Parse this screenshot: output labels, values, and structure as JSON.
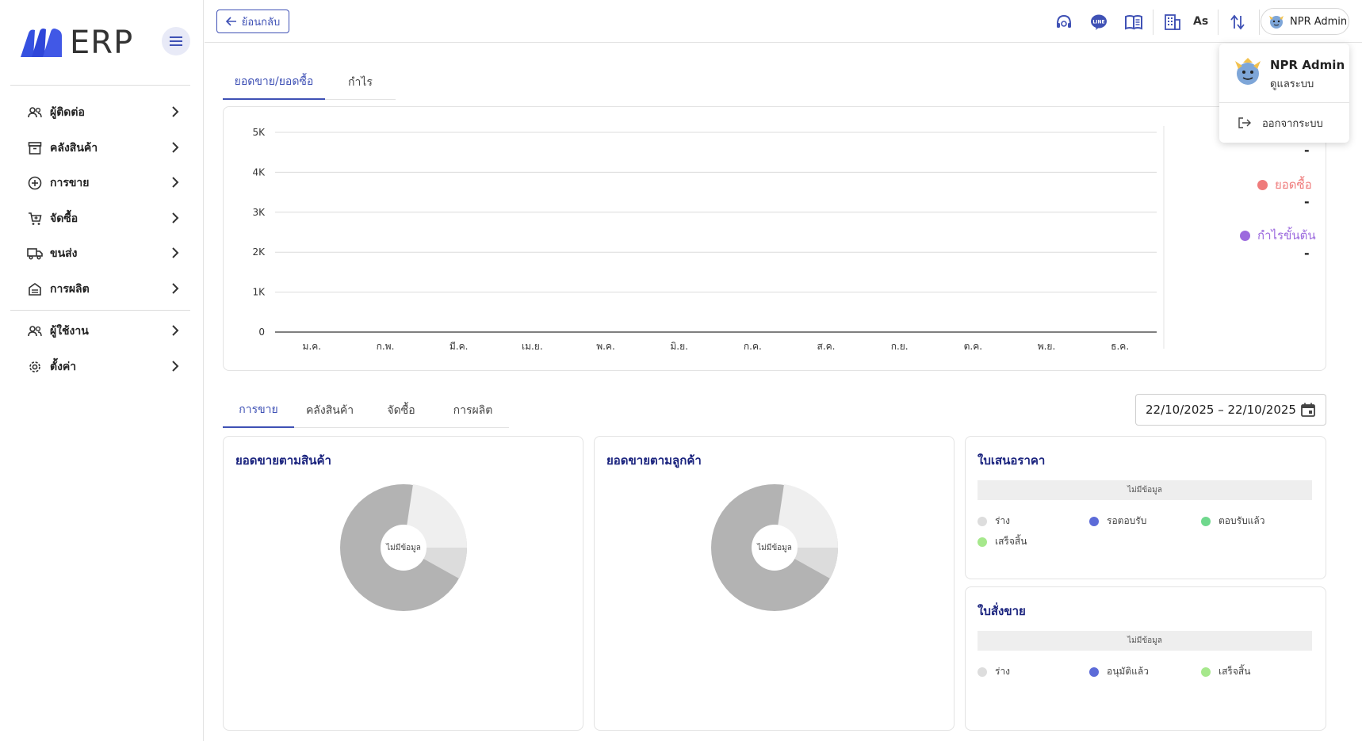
{
  "app": {
    "brand_text": "ERP"
  },
  "sidebar": {
    "items": [
      {
        "label": "ผู้ติดต่อ",
        "icon": "contacts-icon"
      },
      {
        "label": "คลังสินค้า",
        "icon": "warehouse-icon"
      },
      {
        "label": "การขาย",
        "icon": "plus-circle-icon"
      },
      {
        "label": "จัดซื้อ",
        "icon": "cart-icon"
      },
      {
        "label": "ขนส่ง",
        "icon": "truck-icon"
      },
      {
        "label": "การผลิต",
        "icon": "factory-icon"
      },
      {
        "label": "ผู้ใช้งาน",
        "icon": "users-icon"
      },
      {
        "label": "ตั้งค่า",
        "icon": "gear-icon"
      }
    ]
  },
  "topbar": {
    "back_label": "ย้อนกลับ",
    "as_label": "As",
    "user_name": "NPR Admin",
    "icons": [
      "support-icon",
      "line-icon",
      "book-icon",
      "building-icon",
      "swap-icon"
    ]
  },
  "user_menu": {
    "name": "NPR Admin",
    "role": "ดูแลระบบ",
    "logout_label": "ออกจากระบบ"
  },
  "main_tabs": [
    {
      "label": "ยอดขาย/ยอดซื้อ",
      "active": true
    },
    {
      "label": "กำไร",
      "active": false
    }
  ],
  "chart_data": {
    "type": "line",
    "categories": [
      "ม.ค.",
      "ก.พ.",
      "มี.ค.",
      "เม.ย.",
      "พ.ค.",
      "มิ.ย.",
      "ก.ค.",
      "ส.ค.",
      "ก.ย.",
      "ต.ค.",
      "พ.ย.",
      "ธ.ค."
    ],
    "y_ticks": [
      "0",
      "1K",
      "2K",
      "3K",
      "4K",
      "5K"
    ],
    "ylim": [
      0,
      5000
    ],
    "grid": true,
    "series": [
      {
        "name": "ยอดซื้อ",
        "color": "#ef7b7b",
        "values": [],
        "total": "-"
      },
      {
        "name": "กำไรขั้นต้น",
        "color": "#9c6ade",
        "values": [],
        "total": "-"
      }
    ],
    "legend_first_value": "-",
    "legend_position": "right"
  },
  "bottom_tabs": [
    {
      "label": "การขาย",
      "active": true
    },
    {
      "label": "คลังสินค้า",
      "active": false
    },
    {
      "label": "จัดซื้อ",
      "active": false
    },
    {
      "label": "การผลิต",
      "active": false
    }
  ],
  "date_range": "22/10/2025 – 22/10/2025",
  "cards": {
    "sales_by_product": {
      "title": "ยอดขายตามสินค้า",
      "no_data": "ไม่มีข้อมูล"
    },
    "sales_by_customer": {
      "title": "ยอดขายตามลูกค้า",
      "no_data": "ไม่มีข้อมูล"
    },
    "quotation": {
      "title": "ใบเสนอราคา",
      "no_data": "ไม่มีข้อมูล",
      "statuses": [
        {
          "label": "ร่าง",
          "color": "#dddddd"
        },
        {
          "label": "รอตอบรับ",
          "color": "#5c6bd8"
        },
        {
          "label": "ตอบรับแล้ว",
          "color": "#6fd88d"
        },
        {
          "label": "เสร็จสิ้น",
          "color": "#a6e88c"
        }
      ]
    },
    "sales_order": {
      "title": "ใบสั่งขาย",
      "no_data": "ไม่มีข้อมูล",
      "statuses": [
        {
          "label": "ร่าง",
          "color": "#dddddd"
        },
        {
          "label": "อนุมัติแล้ว",
          "color": "#5c6bd8"
        },
        {
          "label": "เสร็จสิ้น",
          "color": "#a6e88c"
        }
      ]
    }
  },
  "colors": {
    "accent": "#3f51b5",
    "title_navy": "#1a237e",
    "logo_blue": "#2f46d9"
  }
}
